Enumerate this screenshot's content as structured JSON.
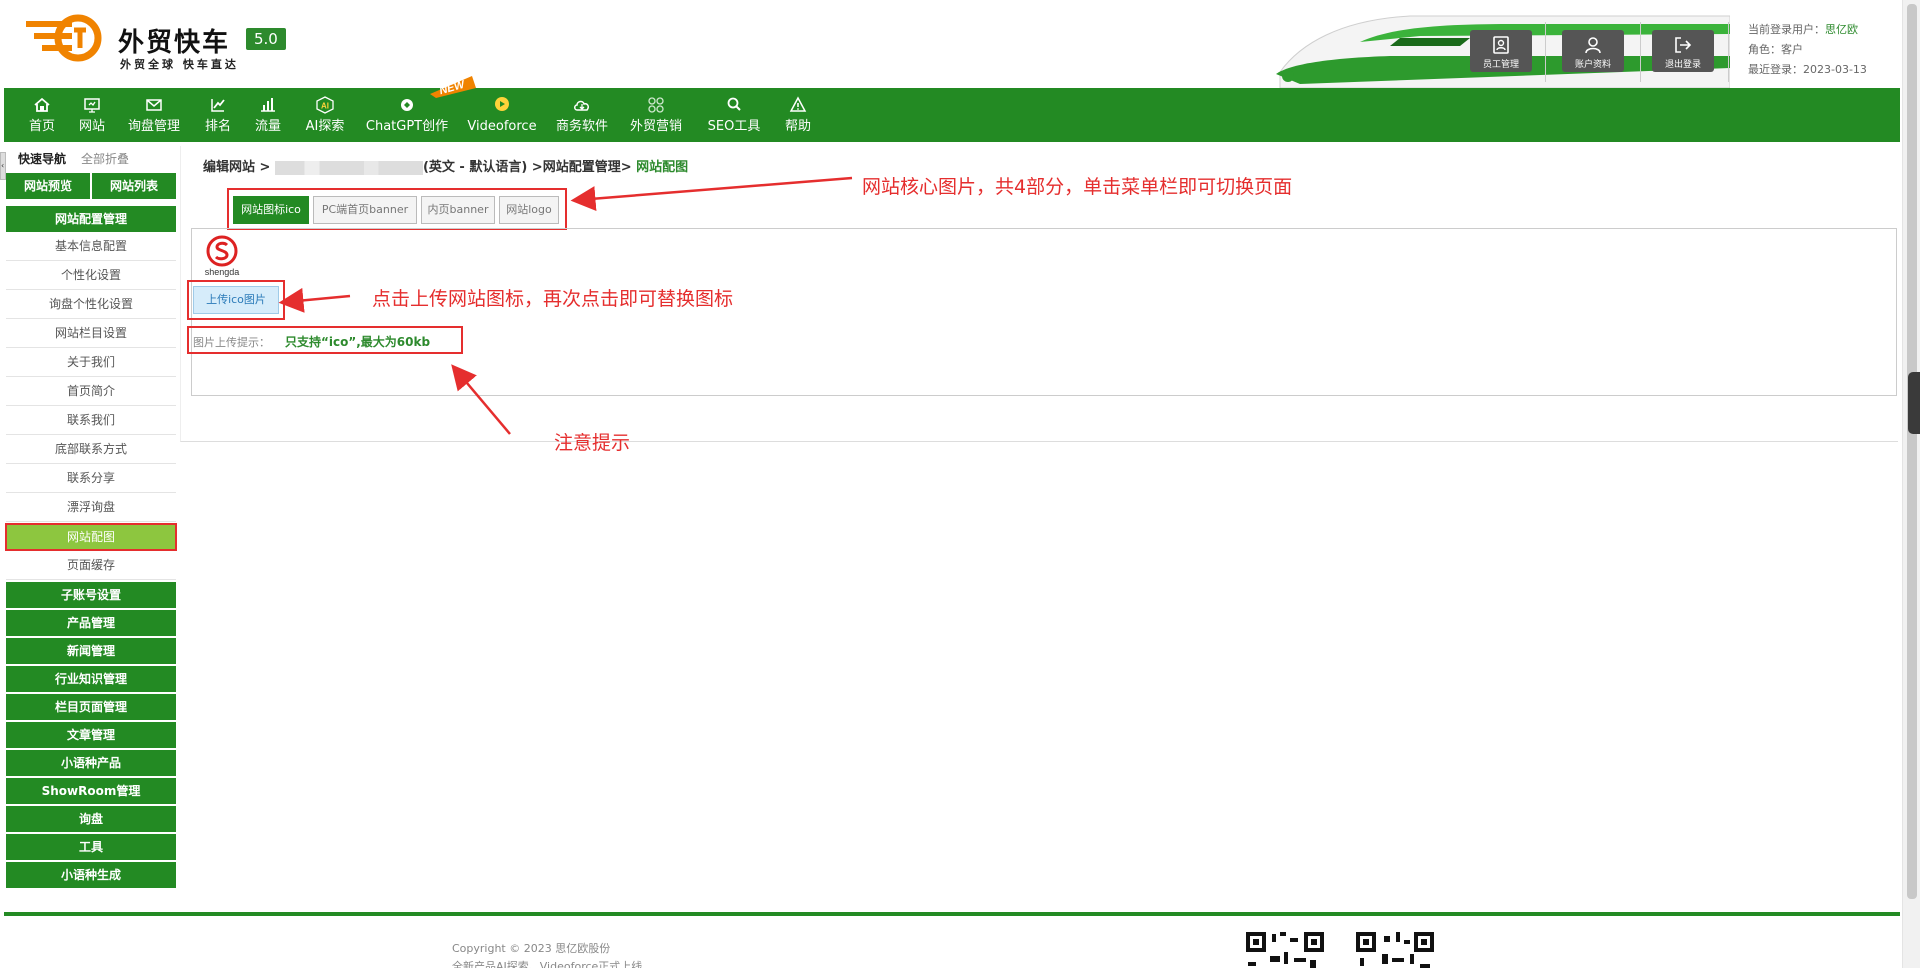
{
  "header": {
    "logo_title": "外贸快车",
    "logo_slogan": "外贸全球 快车直达",
    "version": "5.0",
    "buttons": [
      {
        "label": "员工管理",
        "icon": "staff-icon"
      },
      {
        "label": "账户资料",
        "icon": "account-icon"
      },
      {
        "label": "退出登录",
        "icon": "logout-icon"
      }
    ],
    "user": {
      "current_user_label": "当前登录用户：",
      "current_user": "思亿欧",
      "role_label": "角色：",
      "role": "客户",
      "last_login_label": "最近登录：",
      "last_login": "2023-03-13"
    }
  },
  "nav": {
    "items": [
      {
        "label": "首页",
        "icon": "home-icon"
      },
      {
        "label": "网站",
        "icon": "monitor-icon"
      },
      {
        "label": "询盘管理",
        "icon": "mail-icon"
      },
      {
        "label": "排名",
        "icon": "ranking-icon"
      },
      {
        "label": "流量",
        "icon": "bar-chart-icon"
      },
      {
        "label": "AI探索",
        "icon": "ai-icon"
      },
      {
        "label": "ChatGPT创作",
        "icon": "chatgpt-icon"
      },
      {
        "label": "Videoforce",
        "icon": "video-icon"
      },
      {
        "label": "商务软件",
        "icon": "cloud-icon"
      },
      {
        "label": "外贸营销",
        "icon": "grid-icon"
      },
      {
        "label": "SEO工具",
        "icon": "search-icon"
      },
      {
        "label": "帮助",
        "icon": "warning-icon"
      }
    ],
    "new_badge": "NEW"
  },
  "sidebar": {
    "quick_nav": "快速导航",
    "fold_all": "全部折叠",
    "preview": "网站预览",
    "site_list": "网站列表",
    "config_section": "网站配置管理",
    "config_items": [
      "基本信息配置",
      "个性化设置",
      "询盘个性化设置",
      "网站栏目设置",
      "关于我们",
      "首页简介",
      "联系我们",
      "底部联系方式",
      "联系分享",
      "漂浮询盘",
      "网站配图",
      "页面缓存"
    ],
    "active_item": "网站配图",
    "sections": [
      "子账号设置",
      "产品管理",
      "新闻管理",
      "行业知识管理",
      "栏目页面管理",
      "文章管理",
      "小语种产品",
      "ShowRoom管理",
      "询盘",
      "工具",
      "小语种生成"
    ]
  },
  "main": {
    "breadcrumb": {
      "part1": "编辑网站 > ",
      "part2": "(英文 - 默认语言) >网站配置管理> ",
      "current": "网站配图"
    },
    "tabs": [
      "网站图标ico",
      "PC端首页banner",
      "内页banner",
      "网站logo"
    ],
    "active_tab": "网站图标ico",
    "preview_caption": "shengda",
    "upload_button": "上传ico图片",
    "hint_label": "图片上传提示：",
    "hint_text": "只支持“ico”,最大为60kb"
  },
  "annotations": {
    "tabs_note": "网站核心图片，共4部分，单击菜单栏即可切换页面",
    "upload_note": "点击上传网站图标，再次点击即可替换图标",
    "hint_note": "注意提示"
  },
  "footer": {
    "copyright": "Copyright © 2023 思亿欧股份",
    "news": "全新产品AI探索、Videoforce正式上线"
  },
  "colors": {
    "brand_green": "#238a23",
    "active_light_green": "#8dc63f",
    "annotation_red": "#e52e2e",
    "logo_orange": "#f08300"
  }
}
